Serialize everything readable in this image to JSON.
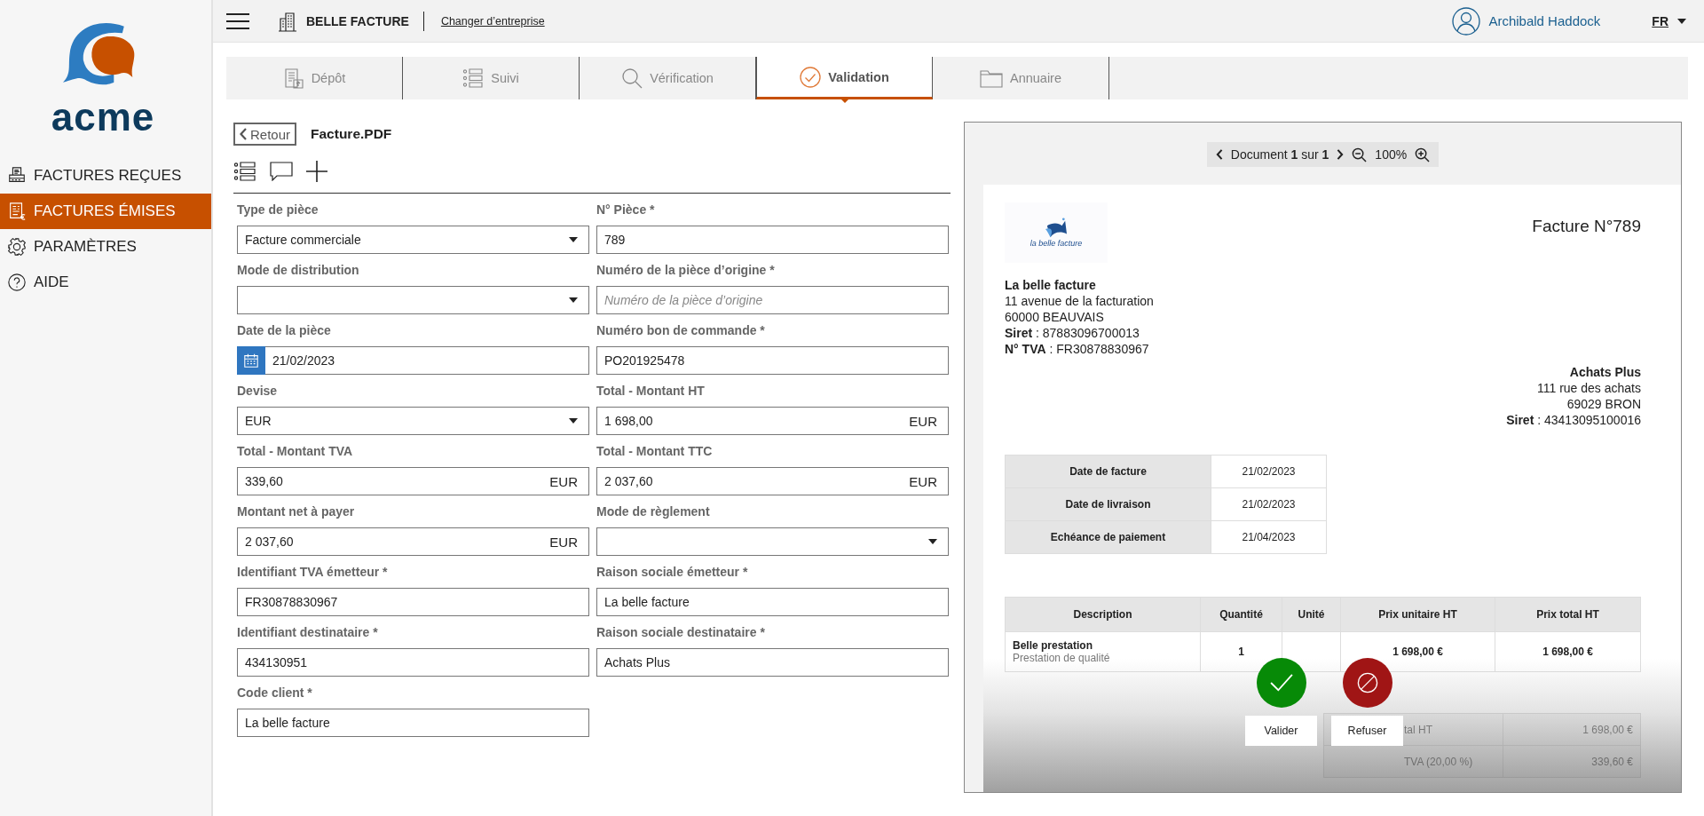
{
  "sidebar": {
    "logo_text": "acme",
    "items": [
      {
        "label": "FACTURES REÇUES",
        "selected": false
      },
      {
        "label": "FACTURES ÉMISES",
        "selected": true
      },
      {
        "label": "PARAMÈTRES",
        "selected": false
      },
      {
        "label": "AIDE",
        "selected": false
      }
    ]
  },
  "header": {
    "company": "BELLE FACTURE",
    "change_link": "Changer d’entreprise",
    "user": "Archibald Haddock",
    "language": "FR"
  },
  "tabs": [
    {
      "label": "Dépôt",
      "selected": false
    },
    {
      "label": "Suivi",
      "selected": false
    },
    {
      "label": "Vérification",
      "selected": false
    },
    {
      "label": "Validation",
      "selected": true
    },
    {
      "label": "Annuaire",
      "selected": false
    }
  ],
  "form": {
    "back": "Retour",
    "file_name": "Facture.PDF",
    "fields": [
      {
        "label": "Type de pièce",
        "kind": "select",
        "value": "Facture commerciale"
      },
      {
        "label": "N° Pièce *",
        "kind": "text",
        "value": "789"
      },
      {
        "label": "Mode de distribution",
        "kind": "select"
      },
      {
        "label": "Numéro de la pièce d’origine *",
        "kind": "text",
        "placeholder": "Numéro de la pièce d’origine"
      },
      {
        "label": "Date de la pièce",
        "kind": "date",
        "value": "21/02/2023"
      },
      {
        "label": "Numéro bon de commande *",
        "kind": "text",
        "value": "PO201925478"
      },
      {
        "label": "Devise",
        "kind": "select",
        "value": "EUR"
      },
      {
        "label": "Total - Montant HT",
        "kind": "amount",
        "value": "1 698,00",
        "unit": "EUR"
      },
      {
        "label": "Total - Montant TVA",
        "kind": "amount",
        "value": "339,60",
        "unit": "EUR"
      },
      {
        "label": "Total - Montant TTC",
        "kind": "amount",
        "value": "2 037,60",
        "unit": "EUR"
      },
      {
        "label": "Montant net à payer",
        "kind": "amount",
        "value": "2 037,60",
        "unit": "EUR"
      },
      {
        "label": "Mode de règlement",
        "kind": "select"
      },
      {
        "label": "Identifiant TVA émetteur *",
        "kind": "text",
        "value": "FR30878830967"
      },
      {
        "label": "Raison sociale émetteur *",
        "kind": "text",
        "value": "La belle facture"
      },
      {
        "label": "Identifiant destinataire *",
        "kind": "text",
        "value": "434130951"
      },
      {
        "label": "Raison sociale destinataire *",
        "kind": "text",
        "value": "Achats Plus"
      },
      {
        "label": "Code client *",
        "kind": "text",
        "value": "La belle facture"
      }
    ]
  },
  "viewer": {
    "pager": "Document **1** sur **1**",
    "zoom": "100%",
    "document": {
      "title": "Facture N°789",
      "logo_text": "la belle facture",
      "seller": {
        "name": "La belle facture",
        "lines": [
          "11 avenue de la facturation",
          "60000 BEAUVAIS",
          "**Siret** : 87883096700013",
          "**N° TVA** : FR30878830967"
        ]
      },
      "buyer": {
        "name": "Achats Plus",
        "lines": [
          "111 rue des achats",
          "69029 BRON",
          "**Siret** : 43413095100016"
        ]
      },
      "dates": [
        {
          "label": "Date de facture",
          "value": "21/02/2023"
        },
        {
          "label": "Date de livraison",
          "value": "21/02/2023"
        },
        {
          "label": "Echéance de paiement",
          "value": "21/04/2023"
        }
      ],
      "items_table": {
        "columns": [
          "Description",
          "Quantité",
          "Unité",
          "Prix unitaire HT",
          "Prix total HT"
        ],
        "rows": [
          {
            "description": "Belle prestation",
            "detail": "Prestation de qualité",
            "quantity": "1",
            "unit_price": "1 698,00 €",
            "total": "1 698,00 €"
          }
        ]
      },
      "totals": [
        {
          "label": "tal HT",
          "value": "1 698,00 €"
        },
        {
          "label": "TVA (20,00 %)",
          "value": "339,60 €"
        }
      ]
    },
    "actions": [
      {
        "label": "Valider",
        "kind": "accept"
      },
      {
        "label": "Refuser",
        "kind": "reject"
      }
    ]
  }
}
